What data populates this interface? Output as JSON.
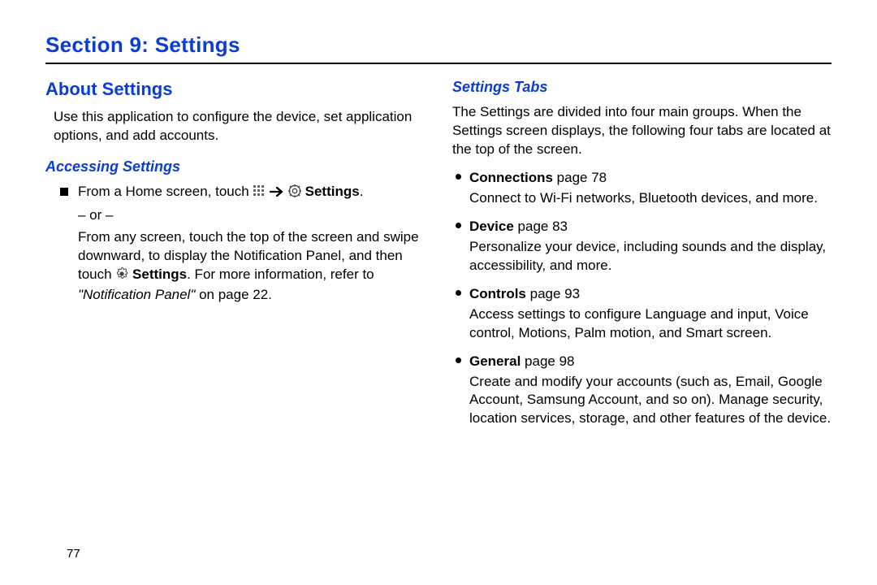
{
  "section_title": "Section 9: Settings",
  "page_number": "77",
  "left": {
    "h2": "About Settings",
    "intro": "Use this application to configure the device, set application options, and add accounts.",
    "h3": "Accessing Settings",
    "step_prefix": "From a Home screen, touch ",
    "step_suffix_bold": "Settings",
    "step_suffix_period": ".",
    "or_text": "– or –",
    "para2_a": "From any screen, touch the top of the screen and swipe downward, to display the Notification Panel, and then touch ",
    "para2_bold": "Settings",
    "para2_b": ". For more information, refer to ",
    "para2_ref": "\"Notification Panel\"",
    "para2_c": " on page 22."
  },
  "right": {
    "h3": "Settings Tabs",
    "intro": "The Settings are divided into four main groups. When the Settings screen displays, the following four tabs are located at the top of the screen.",
    "items": [
      {
        "name": "Connections",
        "page": " page 78",
        "desc": "Connect to Wi-Fi networks, Bluetooth devices, and more."
      },
      {
        "name": "Device",
        "page": " page 83",
        "desc": "Personalize your device, including sounds and the display, accessibility, and more."
      },
      {
        "name": "Controls",
        "page": " page 93",
        "desc": "Access settings to configure Language and input, Voice control, Motions, Palm motion, and Smart screen."
      },
      {
        "name": "General",
        "page": " page 98",
        "desc": "Create and modify your accounts (such as, Email, Google Account, Samsung Account, and so on). Manage security, location services, storage, and other features of the device."
      }
    ]
  }
}
